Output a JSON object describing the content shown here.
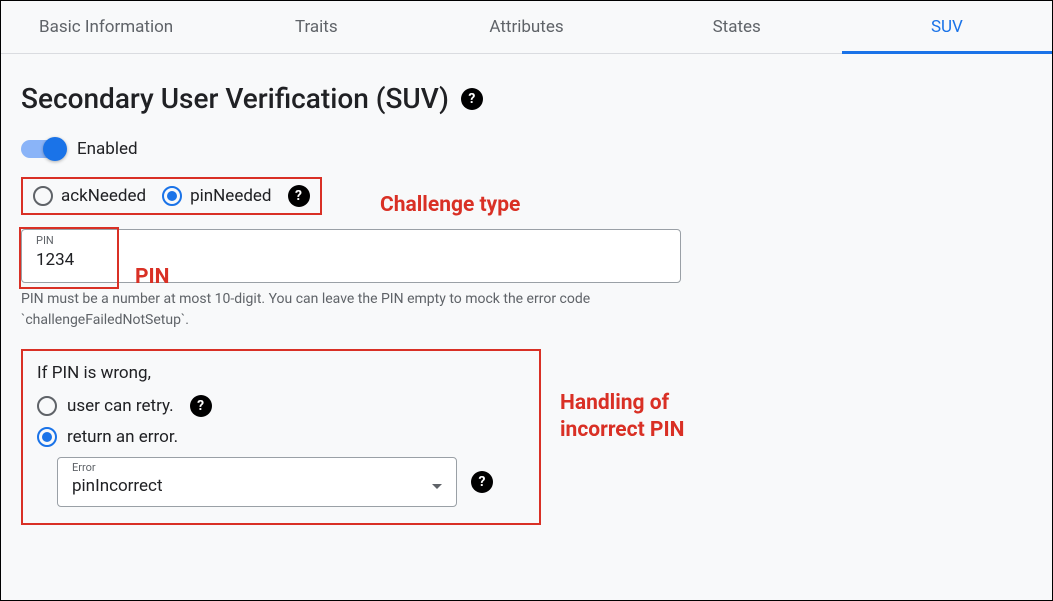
{
  "tabs": [
    {
      "label": "Basic Information",
      "active": false
    },
    {
      "label": "Traits",
      "active": false
    },
    {
      "label": "Attributes",
      "active": false
    },
    {
      "label": "States",
      "active": false
    },
    {
      "label": "SUV",
      "active": true
    }
  ],
  "page": {
    "title": "Secondary User Verification (SUV)"
  },
  "toggle": {
    "label": "Enabled",
    "state": true
  },
  "challenge": {
    "options": {
      "ack": "ackNeeded",
      "pin": "pinNeeded"
    },
    "selected": "pinNeeded"
  },
  "pin_field": {
    "label": "PIN",
    "value": "1234",
    "helper": "PIN must be a number at most 10-digit. You can leave the PIN empty to mock the error code `challengeFailedNotSetup`."
  },
  "error_section": {
    "heading": "If PIN is wrong,",
    "options": {
      "retry": "user can retry.",
      "error": "return an error."
    },
    "selected": "error",
    "select_label": "Error",
    "select_value": "pinIncorrect"
  },
  "annotations": {
    "challenge_type": "Challenge type",
    "pin": "PIN",
    "handling": "Handling of incorrect PIN"
  }
}
